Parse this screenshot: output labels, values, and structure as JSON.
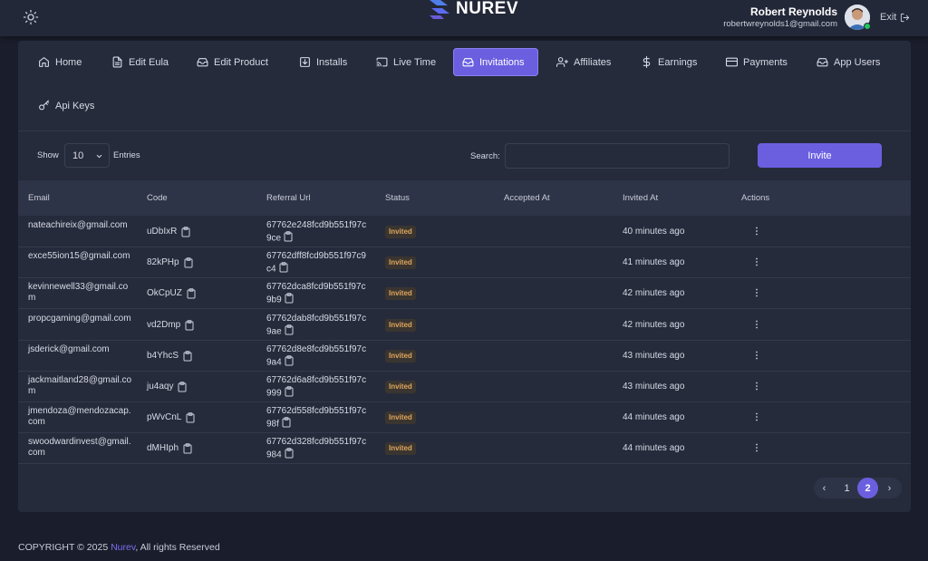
{
  "header": {
    "logo_text": "NUREV",
    "user_name": "Robert Reynolds",
    "user_email": "robertwreynolds1@gmail.com",
    "exit_label": "Exit"
  },
  "tabs": [
    {
      "label": "Home",
      "icon": "home-icon"
    },
    {
      "label": "Edit Eula",
      "icon": "document-icon"
    },
    {
      "label": "Edit Product",
      "icon": "inbox-icon"
    },
    {
      "label": "Installs",
      "icon": "download-box-icon"
    },
    {
      "label": "Live Time",
      "icon": "cast-icon"
    },
    {
      "label": "Invitations",
      "icon": "inbox-icon"
    },
    {
      "label": "Affiliates",
      "icon": "user-plus-icon"
    },
    {
      "label": "Earnings",
      "icon": "dollar-icon"
    },
    {
      "label": "Payments",
      "icon": "credit-card-icon"
    },
    {
      "label": "App Users",
      "icon": "inbox-icon"
    },
    {
      "label": "Api Keys",
      "icon": "key-icon"
    }
  ],
  "active_tab": "Invitations",
  "controls": {
    "show_label": "Show",
    "entries_value": "10",
    "entries_label": "Entries",
    "search_label": "Search:",
    "search_value": "",
    "invite_label": "Invite"
  },
  "table": {
    "columns": [
      "Email",
      "Code",
      "Referral Url",
      "Status",
      "Accepted At",
      "Invited At",
      "Actions"
    ],
    "rows": [
      {
        "email": "nateachireix@gmail.com",
        "code": "uDbIxR",
        "referral": "67762e248fcd9b551f97c9ce",
        "status": "Invited",
        "accepted": "",
        "invited": "40 minutes ago"
      },
      {
        "email": "exce55ion15@gmail.com",
        "code": "82kPHp",
        "referral": "67762dff8fcd9b551f97c9c4",
        "status": "Invited",
        "accepted": "",
        "invited": "41 minutes ago"
      },
      {
        "email": "kevinnewell33@gmail.com",
        "code": "OkCpUZ",
        "referral": "67762dca8fcd9b551f97c9b9",
        "status": "Invited",
        "accepted": "",
        "invited": "42 minutes ago"
      },
      {
        "email": "propcgaming@gmail.com",
        "code": "vd2Dmp",
        "referral": "67762dab8fcd9b551f97c9ae",
        "status": "Invited",
        "accepted": "",
        "invited": "42 minutes ago"
      },
      {
        "email": "jsderick@gmail.com",
        "code": "b4YhcS",
        "referral": "67762d8e8fcd9b551f97c9a4",
        "status": "Invited",
        "accepted": "",
        "invited": "43 minutes ago"
      },
      {
        "email": "jackmaitland28@gmail.com",
        "code": "ju4aqy",
        "referral": "67762d6a8fcd9b551f97c999",
        "status": "Invited",
        "accepted": "",
        "invited": "43 minutes ago"
      },
      {
        "email": "jmendoza@mendozacap.com",
        "code": "pWvCnL",
        "referral": "67762d558fcd9b551f97c98f",
        "status": "Invited",
        "accepted": "",
        "invited": "44 minutes ago"
      },
      {
        "email": "swoodwardinvest@gmail.com",
        "code": "dMHIph",
        "referral": "67762d328fcd9b551f97c984",
        "status": "Invited",
        "accepted": "",
        "invited": "44 minutes ago"
      }
    ]
  },
  "pagination": {
    "prev": "‹",
    "pages": [
      "1",
      "2"
    ],
    "current": "2",
    "next": "›"
  },
  "footer": {
    "prefix": "COPYRIGHT © 2025 ",
    "brand": "Nurev",
    "suffix": ", All rights Reserved"
  },
  "colors": {
    "accent": "#6b5fe0",
    "background": "#1a1d2b",
    "card": "#262b3b",
    "status_text": "#e0a65c",
    "online": "#22c55e"
  }
}
